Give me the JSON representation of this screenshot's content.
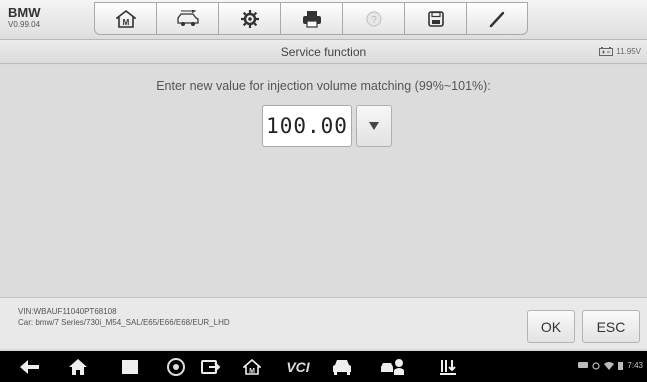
{
  "app": {
    "brand": "BMW",
    "version": "V0.99.04"
  },
  "toolbar": {
    "buttons": [
      {
        "name": "home-icon"
      },
      {
        "name": "vehicle-swap-icon"
      },
      {
        "name": "settings-icon"
      },
      {
        "name": "print-icon"
      },
      {
        "name": "help-icon"
      },
      {
        "name": "save-icon"
      },
      {
        "name": "pen-icon"
      }
    ]
  },
  "titlebar": {
    "title": "Service function",
    "battery": "11.95V"
  },
  "main": {
    "prompt": "Enter new value for injection volume matching (99%~101%):",
    "value": "100.00"
  },
  "footer": {
    "vin": "VIN:WBAUF11040PT68108",
    "car": "Car: bmw/7 Series/730i_M54_SAL/E65/E66/E68/EUR_LHD",
    "ok_label": "OK",
    "esc_label": "ESC"
  },
  "navbar": {
    "vci_label": "VCI",
    "time": "7:43"
  }
}
